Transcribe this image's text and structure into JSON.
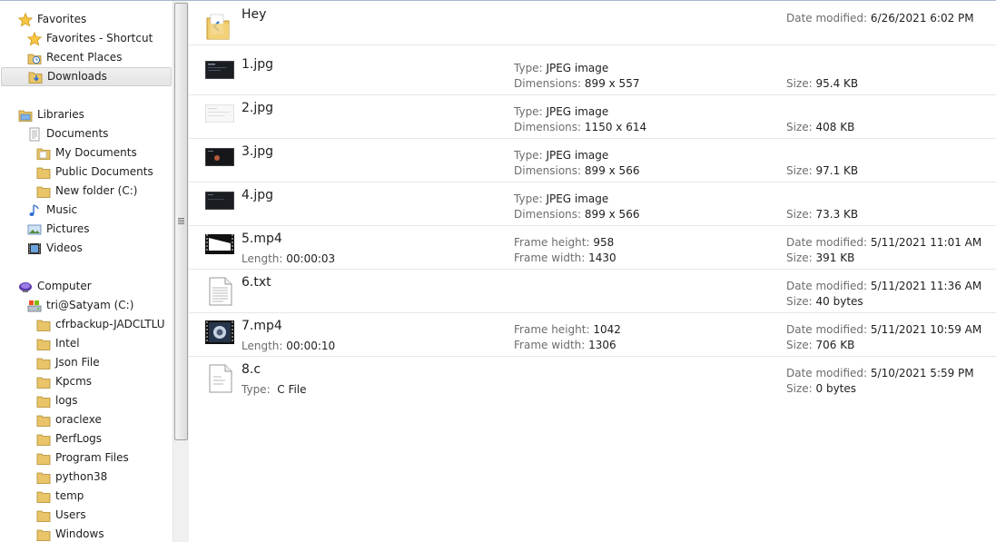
{
  "nav": {
    "favorites": {
      "label": "Favorites",
      "items": [
        {
          "label": "Favorites - Shortcut",
          "icon": "star-icon"
        },
        {
          "label": "Recent Places",
          "icon": "recent-places-icon"
        },
        {
          "label": "Downloads",
          "icon": "downloads-folder-icon",
          "selected": true
        }
      ]
    },
    "libraries": {
      "label": "Libraries",
      "items": [
        {
          "label": "Documents",
          "icon": "documents-icon"
        },
        {
          "label": "My Documents",
          "icon": "folder-icon"
        },
        {
          "label": "Public Documents",
          "icon": "folder-icon"
        },
        {
          "label": "New folder (C:)",
          "icon": "folder-icon"
        },
        {
          "label": "Music",
          "icon": "music-icon"
        },
        {
          "label": "Pictures",
          "icon": "pictures-icon"
        },
        {
          "label": "Videos",
          "icon": "videos-icon"
        }
      ]
    },
    "computer": {
      "label": "Computer",
      "drive": "tri@Satyam (C:)",
      "folders": [
        "cfrbackup-JADCLTLU",
        "Intel",
        "Json File",
        "Kpcms",
        "logs",
        "oraclexe",
        "PerfLogs",
        "Program Files",
        "python38",
        "temp",
        "Users",
        "Windows"
      ]
    }
  },
  "files": [
    {
      "name": "Hey",
      "icon": "vscode-folder-icon",
      "date_label": "Date modified:",
      "date": "6/26/2021 6:02 PM"
    },
    {
      "name": "1.jpg",
      "icon": "dark-image-thumbnail",
      "type_label": "Type:",
      "type": "JPEG image",
      "dim_label": "Dimensions:",
      "dimensions": "899 x 557",
      "size_label": "Size:",
      "size": "95.4 KB"
    },
    {
      "name": "2.jpg",
      "icon": "light-image-thumbnail",
      "type_label": "Type:",
      "type": "JPEG image",
      "dim_label": "Dimensions:",
      "dimensions": "1150 x 614",
      "size_label": "Size:",
      "size": "408 KB"
    },
    {
      "name": "3.jpg",
      "icon": "dark-image-thumbnail",
      "type_label": "Type:",
      "type": "JPEG image",
      "dim_label": "Dimensions:",
      "dimensions": "899 x 566",
      "size_label": "Size:",
      "size": "97.1 KB"
    },
    {
      "name": "4.jpg",
      "icon": "dark-image-thumbnail",
      "type_label": "Type:",
      "type": "JPEG image",
      "dim_label": "Dimensions:",
      "dimensions": "899 x 566",
      "size_label": "Size:",
      "size": "73.3 KB"
    },
    {
      "name": "5.mp4",
      "icon": "video-thumbnail",
      "length_label": "Length:",
      "length": "00:00:03",
      "fh_label": "Frame height:",
      "frame_height": "958",
      "fw_label": "Frame width:",
      "frame_width": "1430",
      "date_label": "Date modified:",
      "date": "5/11/2021 11:01 AM",
      "size_label": "Size:",
      "size": "391 KB"
    },
    {
      "name": "6.txt",
      "icon": "text-file-icon",
      "date_label": "Date modified:",
      "date": "5/11/2021 11:36 AM",
      "size_label": "Size:",
      "size": "40 bytes"
    },
    {
      "name": "7.mp4",
      "icon": "video-thumbnail",
      "length_label": "Length:",
      "length": "00:00:10",
      "fh_label": "Frame height:",
      "frame_height": "1042",
      "fw_label": "Frame width:",
      "frame_width": "1306",
      "date_label": "Date modified:",
      "date": "5/11/2021 10:59 AM",
      "size_label": "Size:",
      "size": "706 KB"
    },
    {
      "name": "8.c",
      "icon": "c-file-icon",
      "type_label": "Type:",
      "type": "C File",
      "date_label": "Date modified:",
      "date": "5/10/2021 5:59 PM",
      "size_label": "Size:",
      "size": "0 bytes"
    }
  ]
}
